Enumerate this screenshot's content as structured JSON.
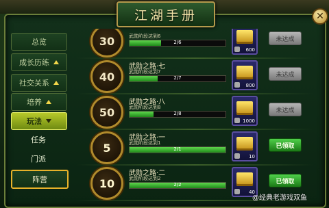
{
  "header": {
    "top_ghost_text": "...",
    "window_title": "江湖手册",
    "close_label": "✕"
  },
  "sidebar": {
    "items": [
      {
        "label": "总览",
        "state": "plain"
      },
      {
        "label": "成长历练",
        "state": "collapsible"
      },
      {
        "label": "社交关系",
        "state": "collapsible"
      },
      {
        "label": "培养",
        "state": "collapsible"
      },
      {
        "label": "玩法",
        "state": "active"
      },
      {
        "label": "任务",
        "state": "plain"
      },
      {
        "label": "门派",
        "state": "plain"
      },
      {
        "label": "阵营",
        "state": "highlight"
      }
    ]
  },
  "achievements": [
    {
      "level": "30",
      "title": "",
      "desc": "武勋阶段达到6",
      "progress_text": "2/6",
      "progress": 0.33,
      "reward_qty": "600",
      "button_label": "未达成",
      "button_state": "disabled"
    },
    {
      "level": "40",
      "title": "武勋之路·七",
      "desc": "武勋阶段达到7",
      "progress_text": "2/7",
      "progress": 0.29,
      "reward_qty": "800",
      "button_label": "未达成",
      "button_state": "disabled"
    },
    {
      "level": "50",
      "title": "武勋之路·八",
      "desc": "武勋阶段达到8",
      "progress_text": "2/8",
      "progress": 0.25,
      "reward_qty": "1000",
      "button_label": "未达成",
      "button_state": "disabled"
    },
    {
      "level": "5",
      "title": "武勋之路·一",
      "desc": "武勋阶段达到1",
      "progress_text": "2/1",
      "progress": 1.0,
      "reward_qty": "10",
      "button_label": "已领取",
      "button_state": "active"
    },
    {
      "level": "10",
      "title": "武勋之路·二",
      "desc": "武勋阶段达到2",
      "progress_text": "2/2",
      "progress": 1.0,
      "reward_qty": "40",
      "button_label": "已领取",
      "button_state": "active"
    }
  ],
  "watermark": "@经典老游戏双鱼",
  "colors": {
    "gold": "#f3d64a",
    "active_green": "#4fd04a",
    "frame": "#6b7f3a"
  }
}
